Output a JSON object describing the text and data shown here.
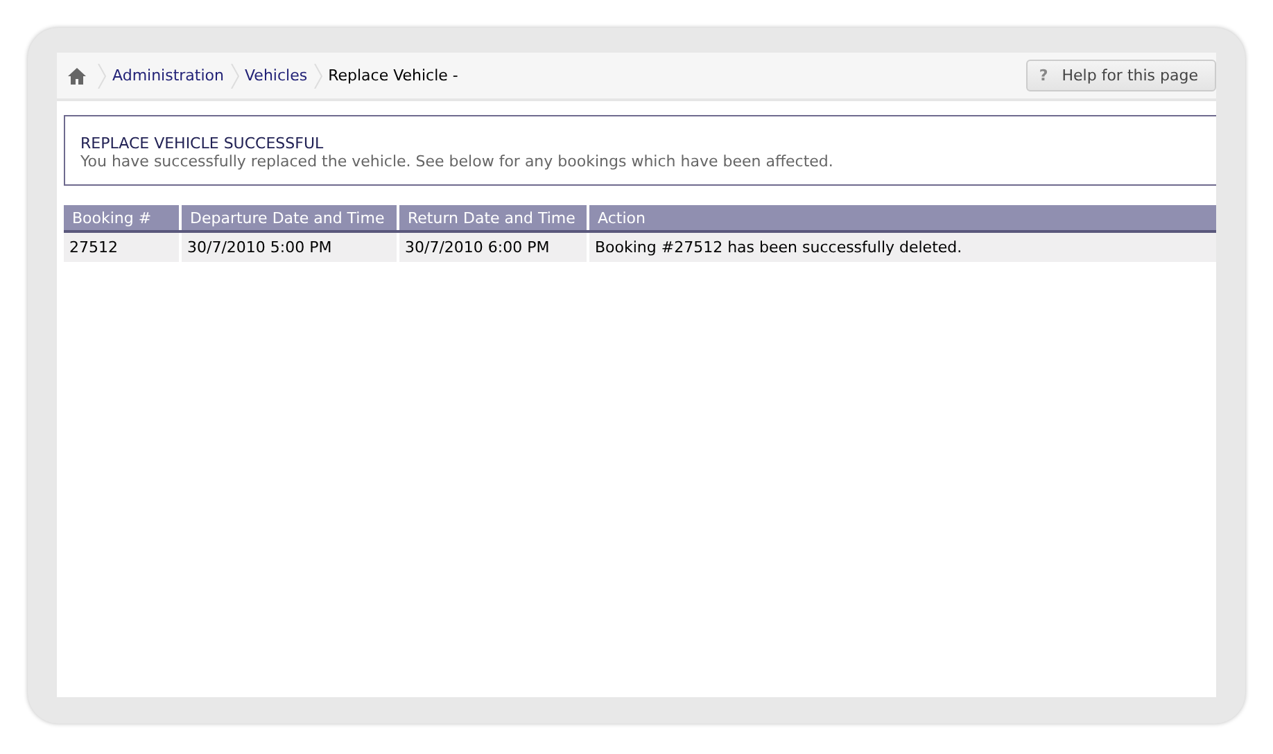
{
  "breadcrumb": [
    {
      "label": "Administration",
      "kind": "link"
    },
    {
      "label": "Vehicles",
      "kind": "link"
    },
    {
      "label": "Replace Vehicle -",
      "kind": "current"
    }
  ],
  "help_button": {
    "icon": "?",
    "label": "Help for this page"
  },
  "message": {
    "title": "REPLACE VEHICLE SUCCESSFUL",
    "text": "You have successfully replaced the vehicle. See below for any bookings which have been affected."
  },
  "table": {
    "columns": [
      "Booking #",
      "Departure Date and Time",
      "Return Date and Time",
      "Action"
    ],
    "rows": [
      [
        "27512",
        "30/7/2010 5:00 PM",
        "30/7/2010 6:00 PM",
        "Booking #27512 has been successfully deleted."
      ]
    ]
  }
}
